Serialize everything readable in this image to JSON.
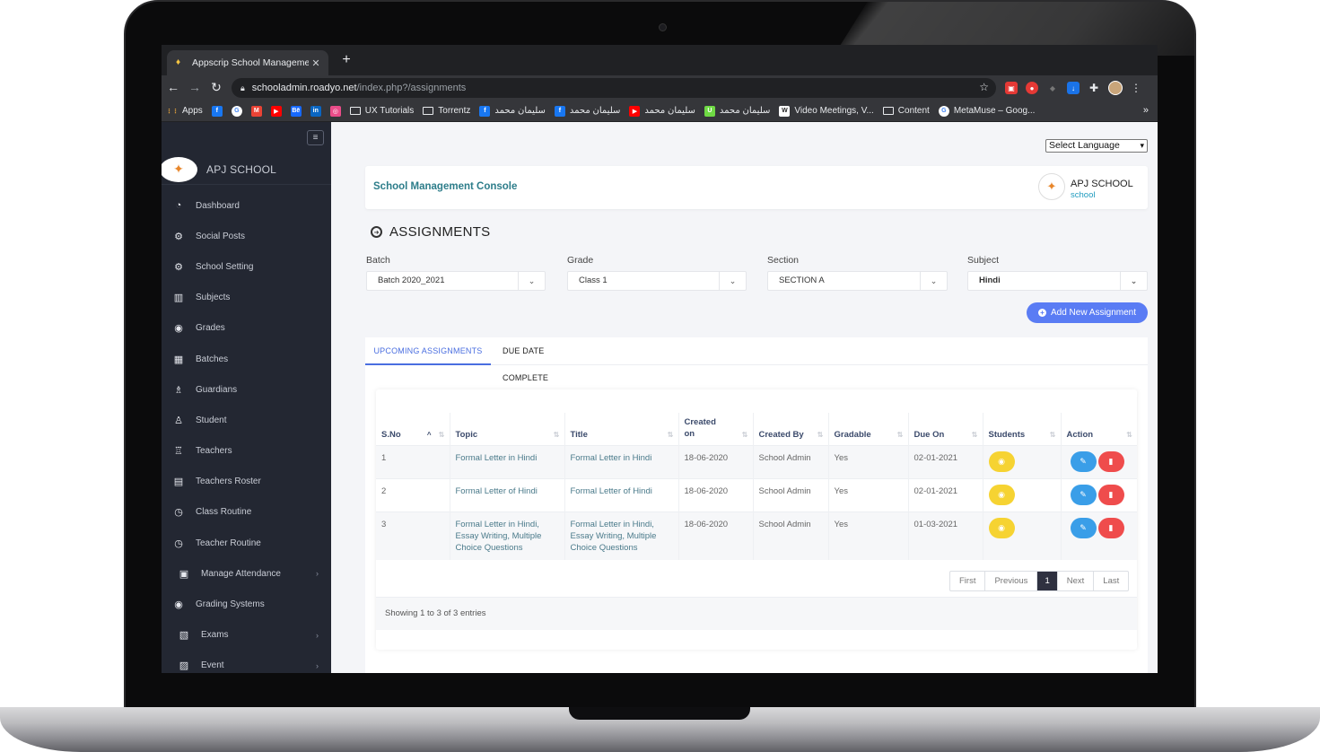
{
  "browser": {
    "tab_title": "Appscrip School Management",
    "tab_close": "✕",
    "new_tab": "+",
    "url_host": "schooladmin.roadyo.net",
    "url_path": "/index.php?/assignments",
    "bookmarks": [
      {
        "label": "Apps",
        "icon": "apps-grid-icon",
        "color": "#e8eaed"
      },
      {
        "label": "",
        "icon": "facebook-icon",
        "color": "#1877f2"
      },
      {
        "label": "",
        "icon": "google-icon",
        "color": "#ffffff"
      },
      {
        "label": "",
        "icon": "gmail-icon",
        "color": "#ea4335"
      },
      {
        "label": "",
        "icon": "youtube-icon",
        "color": "#ff0000"
      },
      {
        "label": "",
        "icon": "behance-icon",
        "color": "#1769ff"
      },
      {
        "label": "",
        "icon": "linkedin-icon",
        "color": "#0a66c2"
      },
      {
        "label": "",
        "icon": "dribbble-icon",
        "color": "#ea4c89"
      },
      {
        "label": "UX Tutorials",
        "icon": "folder-icon",
        "color": ""
      },
      {
        "label": "Torrentz",
        "icon": "folder-icon",
        "color": ""
      },
      {
        "label": "سليمان محمد",
        "icon": "facebook-icon",
        "color": "#1877f2"
      },
      {
        "label": "سليمان محمد",
        "icon": "facebook-icon",
        "color": "#1877f2"
      },
      {
        "label": "سليمان محمد",
        "icon": "youtube-icon",
        "color": "#ff0000"
      },
      {
        "label": "سليمان محمد",
        "icon": "upwork-icon",
        "color": "#6fda44"
      },
      {
        "label": "Video Meetings, V...",
        "icon": "w-icon",
        "color": "#ffffff"
      },
      {
        "label": "Content",
        "icon": "folder-icon",
        "color": ""
      },
      {
        "label": "MetaMuse – Goog...",
        "icon": "google-icon",
        "color": "#ffffff"
      }
    ],
    "bookmarks_more": "»"
  },
  "sidebar": {
    "school_name": "APJ SCHOOL",
    "items": [
      {
        "label": "Dashboard",
        "icon": "dashboard-icon",
        "glyph": "◔",
        "has_submenu": false
      },
      {
        "label": "Social Posts",
        "icon": "gears-icon",
        "glyph": "⚙",
        "has_submenu": false
      },
      {
        "label": "School Setting",
        "icon": "gears-icon",
        "glyph": "⚙",
        "has_submenu": false
      },
      {
        "label": "Subjects",
        "icon": "book-icon",
        "glyph": "▥",
        "has_submenu": false
      },
      {
        "label": "Grades",
        "icon": "grades-icon",
        "glyph": "◉",
        "has_submenu": false
      },
      {
        "label": "Batches",
        "icon": "batches-icon",
        "glyph": "▦",
        "has_submenu": false
      },
      {
        "label": "Guardians",
        "icon": "guardians-icon",
        "glyph": "♗",
        "has_submenu": false
      },
      {
        "label": "Student",
        "icon": "student-icon",
        "glyph": "♙",
        "has_submenu": false
      },
      {
        "label": "Teachers",
        "icon": "teachers-icon",
        "glyph": "♖",
        "has_submenu": false
      },
      {
        "label": "Teachers Roster",
        "icon": "roster-icon",
        "glyph": "▤",
        "has_submenu": false
      },
      {
        "label": "Class Routine",
        "icon": "clock-icon",
        "glyph": "◷",
        "has_submenu": false
      },
      {
        "label": "Teacher Routine",
        "icon": "clock-icon",
        "glyph": "◷",
        "has_submenu": false
      },
      {
        "label": "Manage Attendance",
        "icon": "attendance-icon",
        "glyph": "▣",
        "has_submenu": true
      },
      {
        "label": "Grading Systems",
        "icon": "grading-icon",
        "glyph": "◉",
        "has_submenu": false
      },
      {
        "label": "Exams",
        "icon": "exams-icon",
        "glyph": "▧",
        "has_submenu": true
      },
      {
        "label": "Event",
        "icon": "event-icon",
        "glyph": "▨",
        "has_submenu": true
      }
    ]
  },
  "main": {
    "language_select": "Select Language",
    "console_title": "School Management Console",
    "school_name": "APJ SCHOOL",
    "school_subtitle": "school",
    "page_title": "ASSIGNMENTS",
    "filters": [
      {
        "label": "Batch",
        "value": "Batch 2020_2021",
        "bold": false
      },
      {
        "label": "Grade",
        "value": "Class 1",
        "bold": false
      },
      {
        "label": "Section",
        "value": "SECTION A",
        "bold": false
      },
      {
        "label": "Subject",
        "value": "Hindi",
        "bold": true
      }
    ],
    "add_button": "Add New Assignment",
    "tabs": [
      {
        "label": "UPCOMING ASSIGNMENTS",
        "active": true
      },
      {
        "label": "DUE DATE COMPLETE",
        "active": false
      }
    ],
    "table": {
      "columns": [
        "S.No",
        "Topic",
        "Title",
        "Created on",
        "Created By",
        "Gradable",
        "Due On",
        "Students",
        "Action"
      ],
      "rows": [
        {
          "sno": "1",
          "topic": "Formal Letter in Hindi",
          "title": "Formal Letter in Hindi",
          "created_on": "18-06-2020",
          "created_by": "School Admin",
          "gradable": "Yes",
          "due_on": "02-01-2021"
        },
        {
          "sno": "2",
          "topic": "Formal Letter of Hindi",
          "title": "Formal Letter of Hindi",
          "created_on": "18-06-2020",
          "created_by": "School Admin",
          "gradable": "Yes",
          "due_on": "02-01-2021"
        },
        {
          "sno": "3",
          "topic": "Formal Letter in Hindi, Essay Writing, Multiple Choice Questions",
          "title": "Formal Letter in Hindi, Essay Writing, Multiple Choice Questions",
          "created_on": "18-06-2020",
          "created_by": "School Admin",
          "gradable": "Yes",
          "due_on": "01-03-2021"
        }
      ]
    },
    "pagination": {
      "first": "First",
      "previous": "Previous",
      "current": "1",
      "next": "Next",
      "last": "Last"
    },
    "showing": "Showing 1 to 3 of 3 entries"
  }
}
